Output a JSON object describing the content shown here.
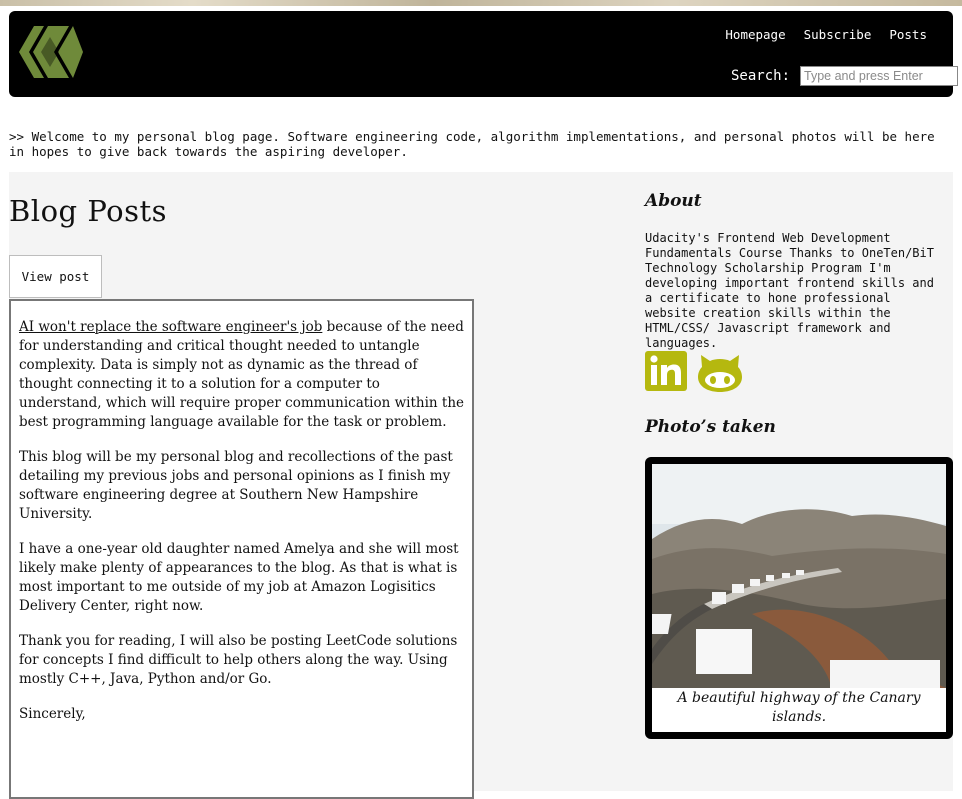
{
  "nav": {
    "logo_icon": "hive-logo-icon",
    "links": [
      "Homepage",
      "Subscribe",
      "Posts"
    ],
    "search_label": "Search:",
    "search_placeholder": "Type and press Enter"
  },
  "welcome": ">> Welcome to my personal blog page. Software engineering code, algorithm implementations, and personal photos will be here in hopes to give back towards the aspiring developer.",
  "main": {
    "title": "Blog Posts",
    "view_post_label": "View post",
    "post": {
      "link_text": "AI won't replace the software engineer's job",
      "p1_rest": " because of the need for understanding and critical thought needed to untangle complexity. Data is simply not as dynamic as the thread of thought connecting it to a solution for a computer to understand, which will require proper communication within the best programming language available for the task or problem.",
      "p2": "This blog will be my personal blog and recollections of the past detailing my previous jobs and personal opinions as I finish my software engineering degree at Southern New Hampshire University.",
      "p3": "I have a one-year old daughter named Amelya and she will most likely make plenty of appearances to the blog. As that is what is most important to me outside of my job at Amazon Logisitics Delivery Center, right now.",
      "p4": "Thank you for reading, I will also be posting LeetCode solutions for concepts I find difficult to help others along the way. Using mostly C++, Java, Python and/or Go.",
      "p5": "Sincerely,"
    }
  },
  "sidebar": {
    "about_heading": "About",
    "about_text": "Udacity's Frontend Web Development Fundamentals Course Thanks to OneTen/BiT Technology Scholarship Program I'm developing important frontend skills and a certificate to hone professional website creation skills within the HTML/CSS/ Javascript framework and languages.",
    "social_icons": [
      "linkedin-icon",
      "github-icon"
    ],
    "social_color": "#b5b80f",
    "photos_heading": "Photo’s taken",
    "photo_caption": "A beautiful highway of the Canary islands."
  }
}
